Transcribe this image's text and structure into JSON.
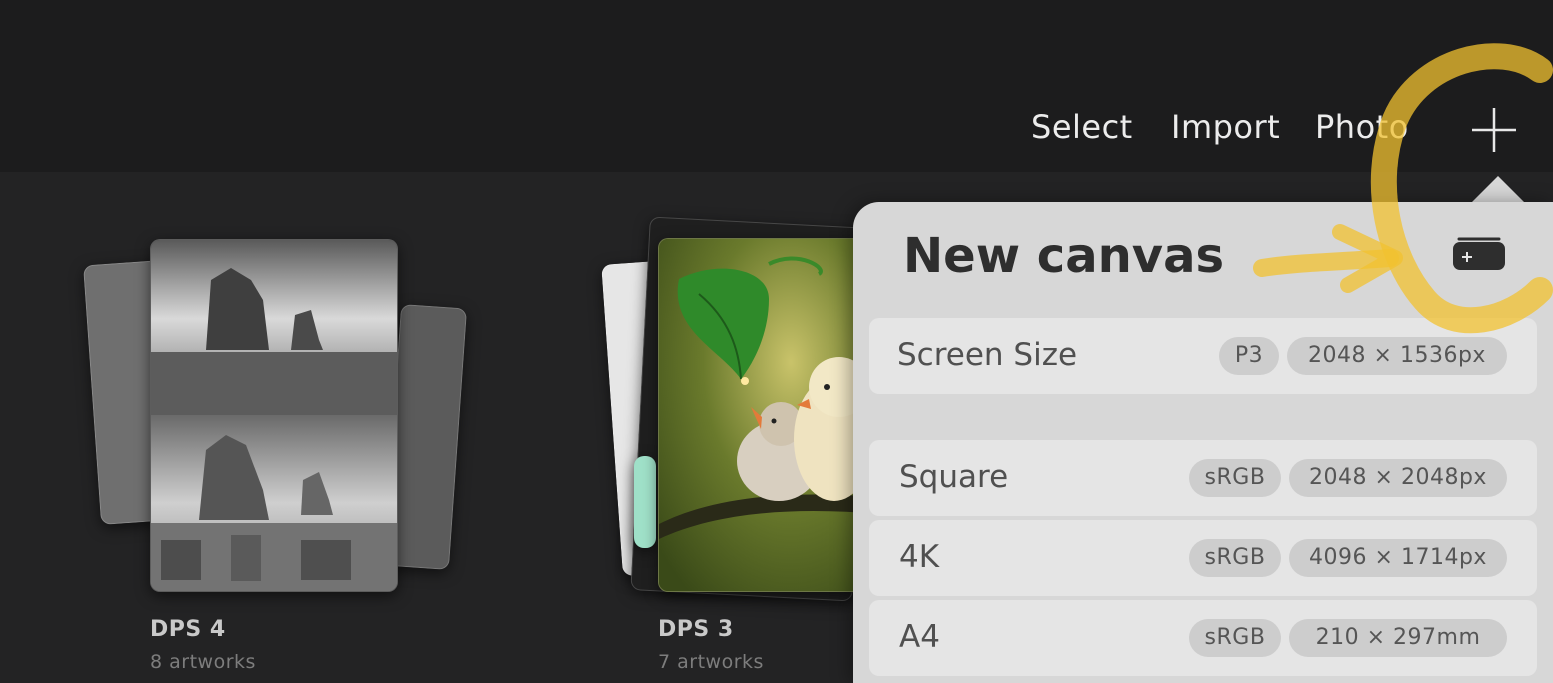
{
  "toolbar": {
    "select_label": "Select",
    "import_label": "Import",
    "photo_label": "Photo",
    "new_icon": "plus-icon"
  },
  "gallery": {
    "stacks": [
      {
        "name": "DPS 4",
        "count": "8 artworks"
      },
      {
        "name": "DPS 3",
        "count": "7 artworks"
      }
    ]
  },
  "new_canvas": {
    "title": "New canvas",
    "custom_icon": "new-custom-canvas-icon",
    "presets": [
      {
        "label": "Screen Size",
        "color_profile": "P3",
        "dimensions": "2048 × 1536px"
      },
      {
        "label": "Square",
        "color_profile": "sRGB",
        "dimensions": "2048 × 2048px"
      },
      {
        "label": "4K",
        "color_profile": "sRGB",
        "dimensions": "4096 × 1714px"
      },
      {
        "label": "A4",
        "color_profile": "sRGB",
        "dimensions": "210 × 297mm"
      }
    ]
  },
  "colors": {
    "background": "#222223",
    "popover": "#d7d7d7",
    "row": "#e5e5e5",
    "pill": "#cdcdcd",
    "highlight": "#f2c230"
  }
}
